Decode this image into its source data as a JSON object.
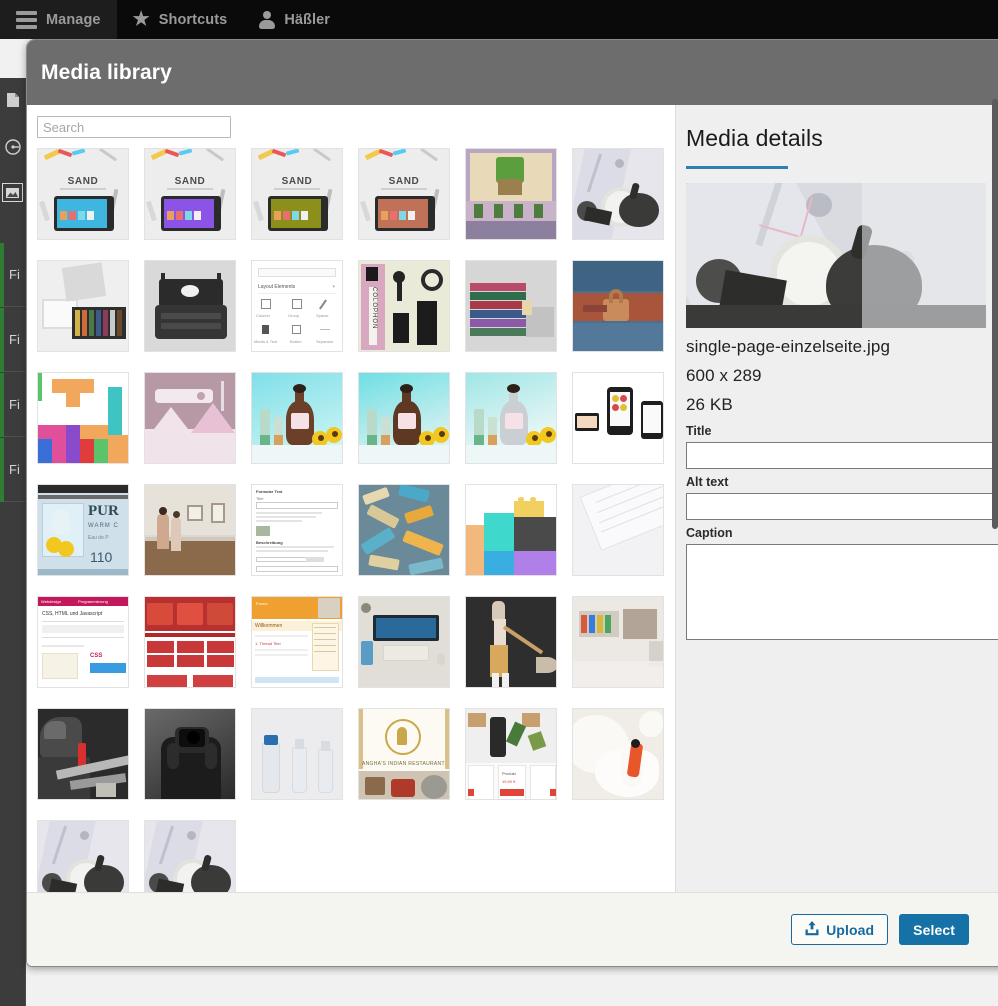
{
  "adminbar": {
    "items": [
      {
        "label": "Manage",
        "icon": "hamburger-icon",
        "active": true
      },
      {
        "label": "Shortcuts",
        "icon": "star-icon",
        "active": false
      },
      {
        "label": "Häßler",
        "icon": "user-icon",
        "active": false
      }
    ]
  },
  "background": {
    "rail_icons": [
      "page-icon",
      "globe-icon",
      "image-icon"
    ],
    "list_items": [
      {
        "label": "Fi"
      },
      {
        "label": "Fi"
      },
      {
        "label": "Fi"
      },
      {
        "label": "Fi"
      }
    ]
  },
  "modal": {
    "title": "Media library",
    "search": {
      "placeholder": "Search",
      "value": ""
    },
    "grid": {
      "items": [
        {
          "name": "sand-tablet-cyan",
          "kind": "sand",
          "accent": "#3fb6e0"
        },
        {
          "name": "sand-tablet-purple",
          "kind": "sand",
          "accent": "#8c54e6"
        },
        {
          "name": "sand-tablet-olive",
          "kind": "sand",
          "accent": "#8d8f1b"
        },
        {
          "name": "sand-tablet-terra",
          "kind": "sand",
          "accent": "#c07258"
        },
        {
          "name": "gallery-drawing",
          "kind": "gallery"
        },
        {
          "name": "bicycle-bell",
          "kind": "bell"
        },
        {
          "name": "paint-tube-box",
          "kind": "paintbox"
        },
        {
          "name": "typewriter",
          "kind": "typewriter"
        },
        {
          "name": "layout-elements-ui",
          "kind": "uipanel"
        },
        {
          "name": "colophon-desk",
          "kind": "colophon"
        },
        {
          "name": "stacked-books",
          "kind": "books"
        },
        {
          "name": "padlock-blue-door",
          "kind": "padlock"
        },
        {
          "name": "tetris-blocks",
          "kind": "tetris"
        },
        {
          "name": "pink-thermometer",
          "kind": "pinkabstract"
        },
        {
          "name": "perfume-bottle-sunflowers-1",
          "kind": "perfume",
          "bottle": "#6b3f28",
          "bg1": "#7fe0e8",
          "bg2": "#bdf0f2"
        },
        {
          "name": "perfume-bottle-sunflowers-2",
          "kind": "perfume",
          "bottle": "#5e3823",
          "bg1": "#6edfe3",
          "bg2": "#cdeff0"
        },
        {
          "name": "perfume-bottle-sunflowers-3",
          "kind": "perfume",
          "bottle": "#c9cfd2",
          "bg1": "#9fe6e6",
          "bg2": "#e6f5f5"
        },
        {
          "name": "responsive-devices",
          "kind": "devices"
        },
        {
          "name": "pure-warm-label",
          "kind": "purelabel"
        },
        {
          "name": "museum-gallery",
          "kind": "museum"
        },
        {
          "name": "form-screenshot",
          "kind": "form"
        },
        {
          "name": "wooden-letters",
          "kind": "letters"
        },
        {
          "name": "lego-bricks",
          "kind": "lego"
        },
        {
          "name": "white-keyboard",
          "kind": "keyboard"
        },
        {
          "name": "css-html-js-site",
          "kind": "site-magenta"
        },
        {
          "name": "fire-trucks-site",
          "kind": "site-red"
        },
        {
          "name": "orange-forum-site",
          "kind": "site-orange"
        },
        {
          "name": "desk-monitor",
          "kind": "deskmonitor"
        },
        {
          "name": "broom-figure",
          "kind": "broom"
        },
        {
          "name": "blurred-shelves",
          "kind": "shelves"
        },
        {
          "name": "welder-workshop",
          "kind": "welder"
        },
        {
          "name": "photographer-bw",
          "kind": "photographer"
        },
        {
          "name": "glass-vials",
          "kind": "vials"
        },
        {
          "name": "indian-restaurant",
          "kind": "restaurant"
        },
        {
          "name": "product-grid-site",
          "kind": "productgrid"
        },
        {
          "name": "white-swan",
          "kind": "swan"
        },
        {
          "name": "bicycle-bell-2",
          "kind": "bell"
        },
        {
          "name": "bicycle-bell-3",
          "kind": "bell"
        }
      ]
    },
    "details": {
      "heading": "Media details",
      "accent_color": "#2f7faf",
      "preview_name": "bicycle-bell-preview",
      "filename": "single-page-einzelseite.jpg",
      "dimensions": "600 x 289",
      "filesize": "26 KB",
      "fields": [
        {
          "label": "Title",
          "name": "title-field",
          "value": "",
          "type": "text"
        },
        {
          "label": "Alt text",
          "name": "alt-text-field",
          "value": "",
          "type": "text"
        },
        {
          "label": "Caption",
          "name": "caption-field",
          "value": "",
          "type": "textarea"
        }
      ]
    },
    "footer": {
      "upload_label": "Upload",
      "select_label": "Select"
    }
  }
}
